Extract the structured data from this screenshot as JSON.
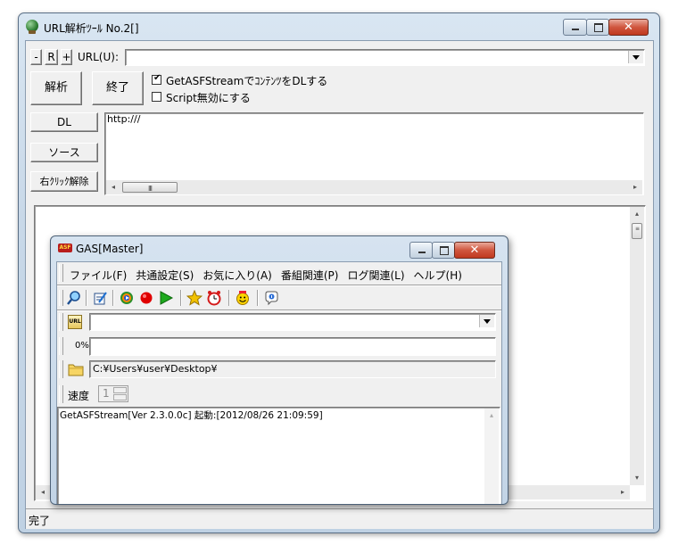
{
  "window": {
    "title": "URL解析ﾂｰﾙ No.2[]"
  },
  "toolbar": {
    "minus_label": "-",
    "r_label": "R",
    "plus_label": "+",
    "url_label": "URL(U):",
    "url_value": ""
  },
  "actions": {
    "analyze_label": "解析",
    "exit_label": "終了",
    "dl_label": "DL",
    "source_label": "ソース",
    "rightclick_label": "右ｸﾘｯｸ解除"
  },
  "options": {
    "getasf_label": "GetASFStreamでｺﾝﾃﾝﾂをDLする",
    "getasf_checked": true,
    "script_label": "Script無効にする",
    "script_checked": false
  },
  "output": {
    "text": "http:///"
  },
  "status": {
    "text": "完了"
  },
  "gas": {
    "title": "GAS[Master]",
    "app_icon_text": "ASF",
    "menu": [
      "ファイル(F)",
      "共通設定(S)",
      "お気に入り(A)",
      "番組関連(P)",
      "ログ関連(L)",
      "ヘルプ(H)"
    ],
    "toolbar_icons": [
      "search-icon",
      "edit-icon",
      "media-player-icon",
      "record-icon",
      "play-icon",
      "star-icon",
      "alarm-clock-icon",
      "smiley-icon",
      "info-icon"
    ],
    "url_badge": "URL",
    "url_value": "",
    "progress_label": "0%",
    "progress_value": 0,
    "folder_path": "C:¥Users¥user¥Desktop¥",
    "speed_label": "速度",
    "speed_value": "1",
    "log_text": "GetASFStream[Ver 2.3.0.0c] 起動:[2012/08/26 21:09:59]"
  },
  "colors": {
    "accent_record": "#e00000",
    "accent_play": "#1faa1f",
    "star": "#f2c200"
  }
}
